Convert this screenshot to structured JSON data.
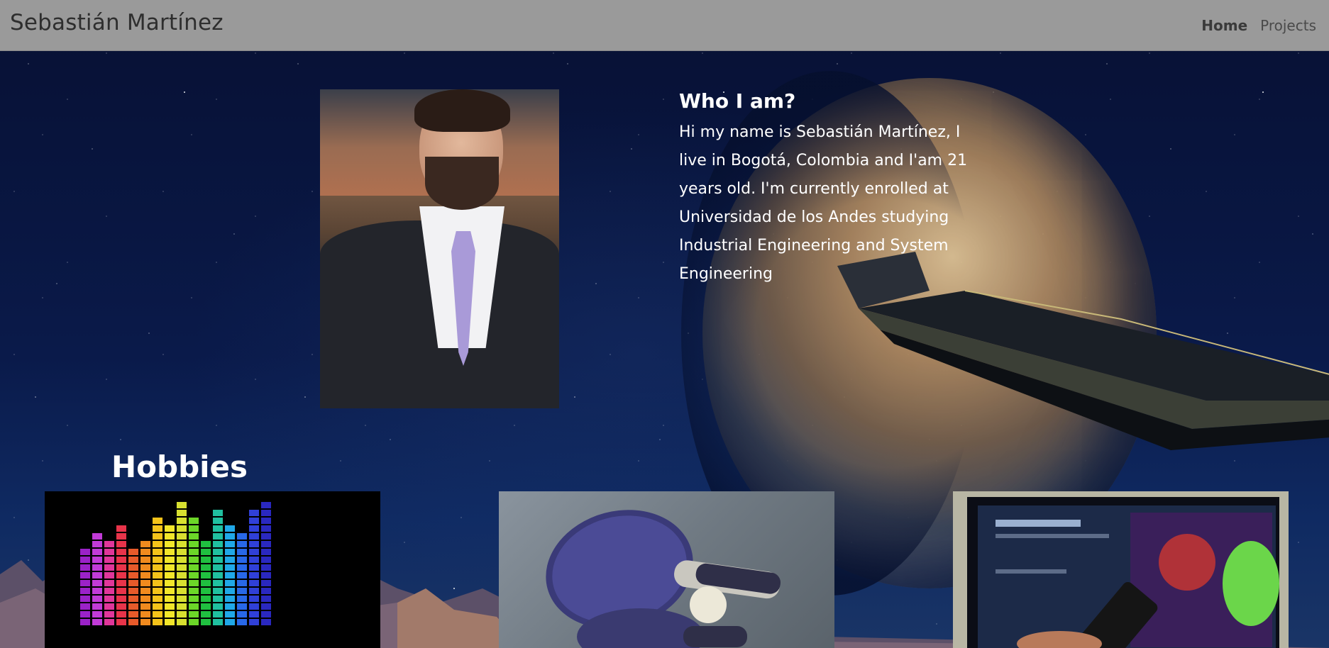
{
  "navbar": {
    "brand": "Sebastián Martínez",
    "links": [
      {
        "label": "Home",
        "active": true
      },
      {
        "label": "Projects",
        "active": false
      }
    ]
  },
  "about": {
    "heading": "Who I am?",
    "text": "Hi my name is Sebastián Martínez, I live in Bogotá, Colombia and I'am 21 years old. I'm currently enrolled at Universidad de los Andes studying Industrial Engineering and System Engineering"
  },
  "hobbies": {
    "title": "Hobbies",
    "items": [
      {
        "name": "music-equalizer"
      },
      {
        "name": "ping-pong"
      },
      {
        "name": "tv-streaming"
      }
    ]
  },
  "colors": {
    "navbar_bg": "#9a9a9a",
    "text_light": "#ffffff",
    "space_dark": "#071033"
  }
}
